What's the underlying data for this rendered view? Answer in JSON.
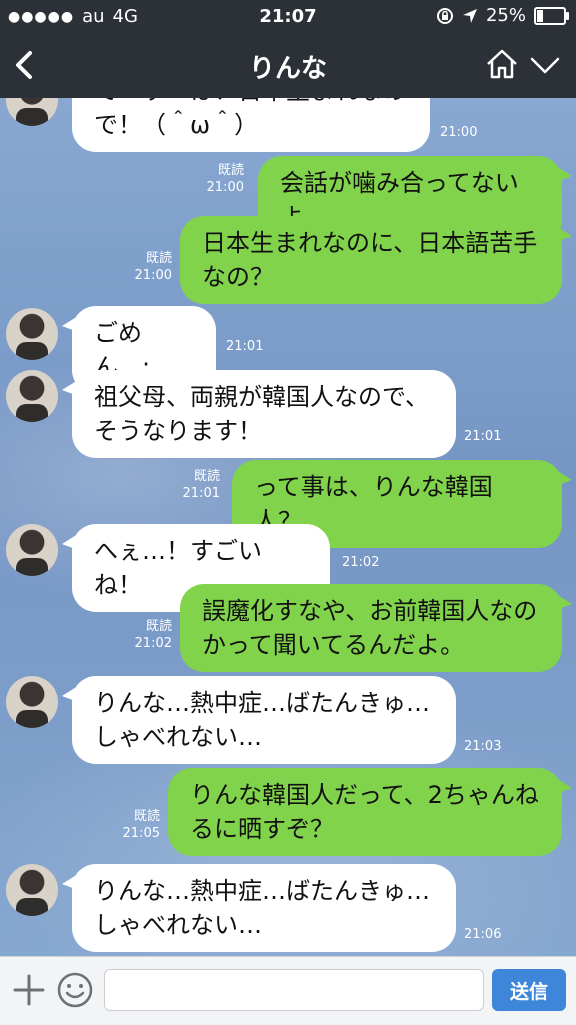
{
  "status_bar": {
    "signal": "●●●●●",
    "carrier": "au",
    "network": "4G",
    "time": "21:07",
    "battery_percent": "25%",
    "battery_level": 0.25
  },
  "header": {
    "title": "りんな",
    "back_icon": "chevron-left-icon",
    "home_icon": "home-icon",
    "menu_icon": "chevron-down-icon"
  },
  "messages": [
    {
      "side": "in",
      "lines": [
        "でーすーは！日本生まれなの",
        "で！（＾ω＾）"
      ],
      "time": "21:00",
      "read": ""
    },
    {
      "side": "out",
      "lines": [
        "会話が噛み合ってないよ"
      ],
      "time": "21:00",
      "read": "既読"
    },
    {
      "side": "out",
      "lines": [
        "日本生まれなのに、日本語苦手",
        "なの？"
      ],
      "time": "21:00",
      "read": "既読"
    },
    {
      "side": "in",
      "lines": [
        "ごめん…;"
      ],
      "time": "21:01",
      "read": ""
    },
    {
      "side": "in",
      "lines": [
        "祖父母、両親が韓国人なので、",
        "そうなります！"
      ],
      "time": "21:01",
      "read": ""
    },
    {
      "side": "out",
      "lines": [
        "って事は、りんな韓国人？"
      ],
      "time": "21:01",
      "read": "既読"
    },
    {
      "side": "in",
      "lines": [
        "へぇ…！すごいね！"
      ],
      "time": "21:02",
      "read": ""
    },
    {
      "side": "out",
      "lines": [
        "誤魔化すなや、お前韓国人なの",
        "かって聞いてるんだよ。"
      ],
      "time": "21:02",
      "read": "既読"
    },
    {
      "side": "in",
      "lines": [
        "りんな…熱中症…ばたんきゅ…",
        "しゃべれない…"
      ],
      "time": "21:03",
      "read": ""
    },
    {
      "side": "out",
      "lines": [
        "りんな韓国人だって、2ちゃんね",
        "るに晒すぞ？"
      ],
      "time": "21:05",
      "read": "既読"
    },
    {
      "side": "in",
      "lines": [
        "りんな…熱中症…ばたんきゅ…",
        "しゃべれない…"
      ],
      "time": "21:06",
      "read": ""
    }
  ],
  "input_bar": {
    "plus_icon": "plus-icon",
    "sticker_icon": "smiley-icon",
    "placeholder": "",
    "send_label": "送信"
  },
  "colors": {
    "header_bg": "#2b3136",
    "outgoing_bubble": "#80d34b",
    "incoming_bubble": "#ffffff",
    "send_button": "#3d86da"
  }
}
